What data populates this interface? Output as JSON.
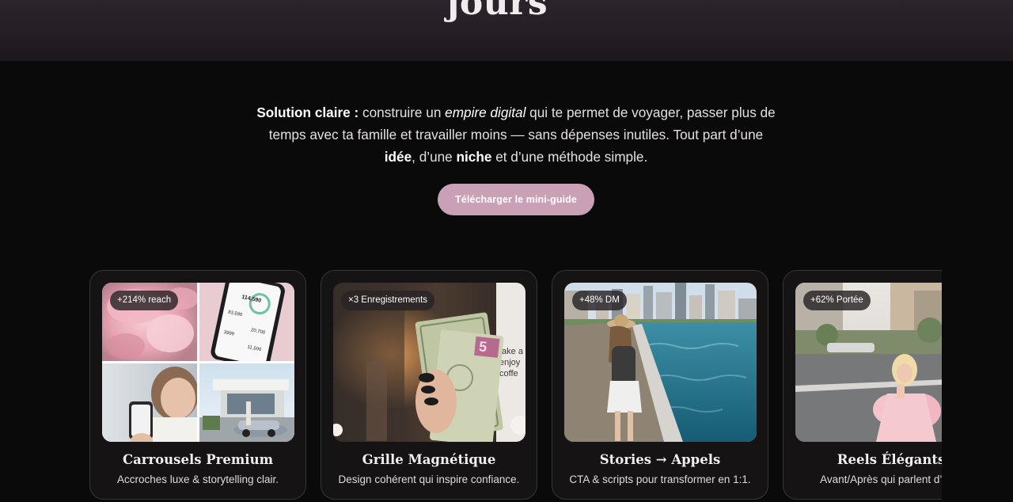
{
  "hero": {
    "title_tail": "jours\""
  },
  "solution": {
    "lead": "Solution claire :",
    "t1": " construire un ",
    "em": "empire digital",
    "t2": " qui te permet de voyager, passer plus de temps avec ta famille et travailler moins — sans dépenses inutiles. Tout part d’une ",
    "b1": "idée",
    "t3": ", d’une ",
    "b2": "niche",
    "t4": " et d’une méthode simple."
  },
  "cta": {
    "label": "Télécharger le mini-guide"
  },
  "cards": [
    {
      "badge": "+214% reach",
      "title": "Carrousels Premium",
      "subtitle": "Accroches luxe & storytelling clair."
    },
    {
      "badge": "×3 Enregistrements",
      "title": "Grille Magnétique",
      "subtitle": "Design cohérent qui inspire confiance."
    },
    {
      "badge": "+48% DM",
      "title": "Stories → Appels",
      "subtitle": "CTA & scripts pour transformer en 1:1."
    },
    {
      "badge": "+62% Portée",
      "title": "Reels Élégants",
      "subtitle": "Avant/Après qui parlent d’eux."
    }
  ],
  "phone_card": {
    "amount": "114,590",
    "row1": "83,590",
    "row2": "20,700",
    "row3": "3999",
    "row4": "11,500"
  },
  "note_fragment": [
    "take a",
    "enjoy",
    "coffe"
  ],
  "colors": {
    "accent": "#c9a0b6",
    "background": "#0b0a0b",
    "card": "#151314"
  }
}
